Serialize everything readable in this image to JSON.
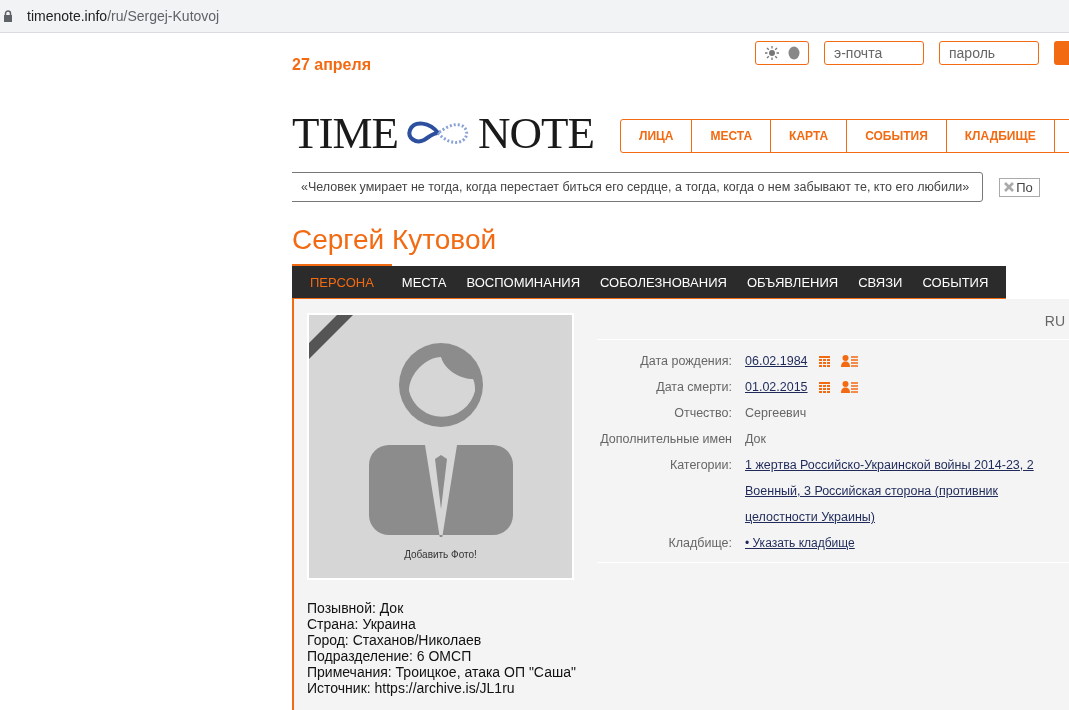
{
  "browser": {
    "url_host": "timenote.info",
    "url_path": "/ru/Sergej-Kutovoj"
  },
  "header": {
    "date": "27 апреля",
    "email_placeholder": "э-почта",
    "password_placeholder": "пароль",
    "dark_mode": false,
    "logo_left": "TIME",
    "logo_right": "NOTE"
  },
  "main_nav": [
    {
      "label": "ЛИЦА"
    },
    {
      "label": "МЕСТА"
    },
    {
      "label": "КАРТА"
    },
    {
      "label": "СОБЫТИЯ"
    },
    {
      "label": "КЛАДБИЩЕ"
    }
  ],
  "quote": "«Человек умирает не тогда, когда перестает биться его сердце, а тогда, когда о нем забывают те, кто его любили»",
  "quote_toggle": {
    "label": "По"
  },
  "person": {
    "name": "Сергей Кутовой"
  },
  "tabs": [
    {
      "label": "ПЕРСОНА",
      "selected": true
    },
    {
      "label": "МЕСТА",
      "selected": false
    },
    {
      "label": "ВОСПОМИНАНИЯ",
      "selected": false
    },
    {
      "label": "СОБОЛЕЗНОВАНИЯ",
      "selected": false
    },
    {
      "label": "ОБЪЯВЛЕНИЯ",
      "selected": false
    },
    {
      "label": "СВЯЗИ",
      "selected": false
    },
    {
      "label": "СОБЫТИЯ",
      "selected": false
    }
  ],
  "language": "RU",
  "photo": {
    "caption": "Добавить Фото!",
    "mourning_ribbon": true
  },
  "details": [
    {
      "kind": "date",
      "label": "Дата рождения:",
      "value": "06.02.1984"
    },
    {
      "kind": "date",
      "label": "Дата смерти:",
      "value": "01.02.2015"
    },
    {
      "kind": "text",
      "label": "Отчество:",
      "value": "Сергеевич"
    },
    {
      "kind": "text",
      "label": "Дополнительные имен",
      "value": "Док"
    },
    {
      "kind": "links",
      "label": "Категории:",
      "value": "1 жертва Российско-Украинской войны 2014-23, 2 Военный, 3 Российская сторона (противник целостности Украины)"
    },
    {
      "kind": "action",
      "label": "Кладбище:",
      "value": "• Указать кладбище"
    }
  ],
  "notes": [
    "Позывной: Док",
    "Страна: Украина",
    "Город: Стаханов/Николаев",
    "Подразделение: 6 ОМСП",
    "Примечания: Троицкое, атака ОП \"Саша\"",
    "Источник: https://archive.is/JL1ru"
  ]
}
